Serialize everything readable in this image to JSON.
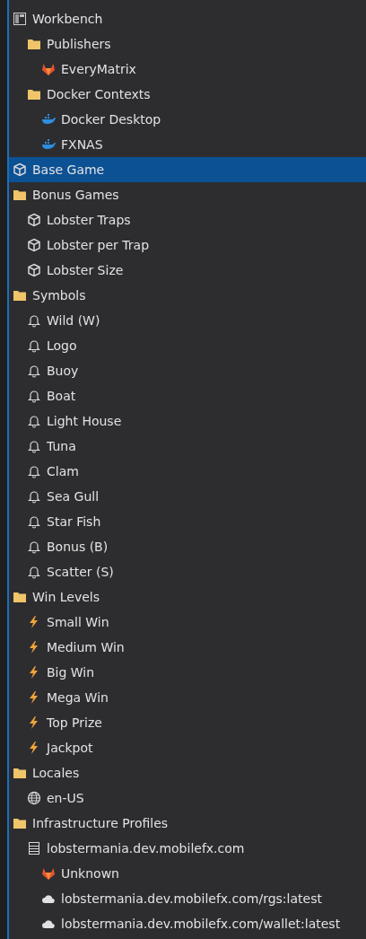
{
  "tree": [
    {
      "label": "Workbench",
      "kind": "workbench",
      "selected": false,
      "children": [
        {
          "label": "Publishers",
          "kind": "folder",
          "selected": false,
          "children": [
            {
              "label": "EveryMatrix",
              "kind": "gitlab",
              "selected": false
            }
          ]
        },
        {
          "label": "Docker Contexts",
          "kind": "folder",
          "selected": false,
          "children": [
            {
              "label": "Docker Desktop",
              "kind": "docker",
              "selected": false
            },
            {
              "label": "FXNAS",
              "kind": "docker",
              "selected": false
            }
          ]
        }
      ]
    },
    {
      "label": "Base Game",
      "kind": "cube",
      "selected": true
    },
    {
      "label": "Bonus Games",
      "kind": "folder",
      "selected": false,
      "children": [
        {
          "label": "Lobster Traps",
          "kind": "cube",
          "selected": false
        },
        {
          "label": "Lobster per Trap",
          "kind": "cube",
          "selected": false
        },
        {
          "label": "Lobster Size",
          "kind": "cube",
          "selected": false
        }
      ]
    },
    {
      "label": "Symbols",
      "kind": "folder",
      "selected": false,
      "children": [
        {
          "label": "Wild (W)",
          "kind": "bell",
          "selected": false
        },
        {
          "label": "Logo",
          "kind": "bell",
          "selected": false
        },
        {
          "label": "Buoy",
          "kind": "bell",
          "selected": false
        },
        {
          "label": "Boat",
          "kind": "bell",
          "selected": false
        },
        {
          "label": "Light House",
          "kind": "bell",
          "selected": false
        },
        {
          "label": "Tuna",
          "kind": "bell",
          "selected": false
        },
        {
          "label": "Clam",
          "kind": "bell",
          "selected": false
        },
        {
          "label": "Sea Gull",
          "kind": "bell",
          "selected": false
        },
        {
          "label": "Star Fish",
          "kind": "bell",
          "selected": false
        },
        {
          "label": "Bonus (B)",
          "kind": "bell",
          "selected": false
        },
        {
          "label": "Scatter (S)",
          "kind": "bell",
          "selected": false
        }
      ]
    },
    {
      "label": "Win Levels",
      "kind": "folder",
      "selected": false,
      "children": [
        {
          "label": "Small Win",
          "kind": "bolt",
          "selected": false
        },
        {
          "label": "Medium Win",
          "kind": "bolt",
          "selected": false
        },
        {
          "label": "Big Win",
          "kind": "bolt",
          "selected": false
        },
        {
          "label": "Mega Win",
          "kind": "bolt",
          "selected": false
        },
        {
          "label": "Top Prize",
          "kind": "bolt",
          "selected": false
        },
        {
          "label": "Jackpot",
          "kind": "bolt",
          "selected": false
        }
      ]
    },
    {
      "label": "Locales",
      "kind": "folder",
      "selected": false,
      "children": [
        {
          "label": "en-US",
          "kind": "globe",
          "selected": false
        }
      ]
    },
    {
      "label": "Infrastructure Profiles",
      "kind": "folder",
      "selected": false,
      "children": [
        {
          "label": "lobstermania.dev.mobilefx.com",
          "kind": "server",
          "selected": false,
          "children": [
            {
              "label": "Unknown",
              "kind": "gitlab",
              "selected": false
            },
            {
              "label": "lobstermania.dev.mobilefx.com/rgs:latest",
              "kind": "cloud",
              "selected": false
            },
            {
              "label": "lobstermania.dev.mobilefx.com/wallet:latest",
              "kind": "cloud",
              "selected": false
            }
          ]
        }
      ]
    }
  ]
}
